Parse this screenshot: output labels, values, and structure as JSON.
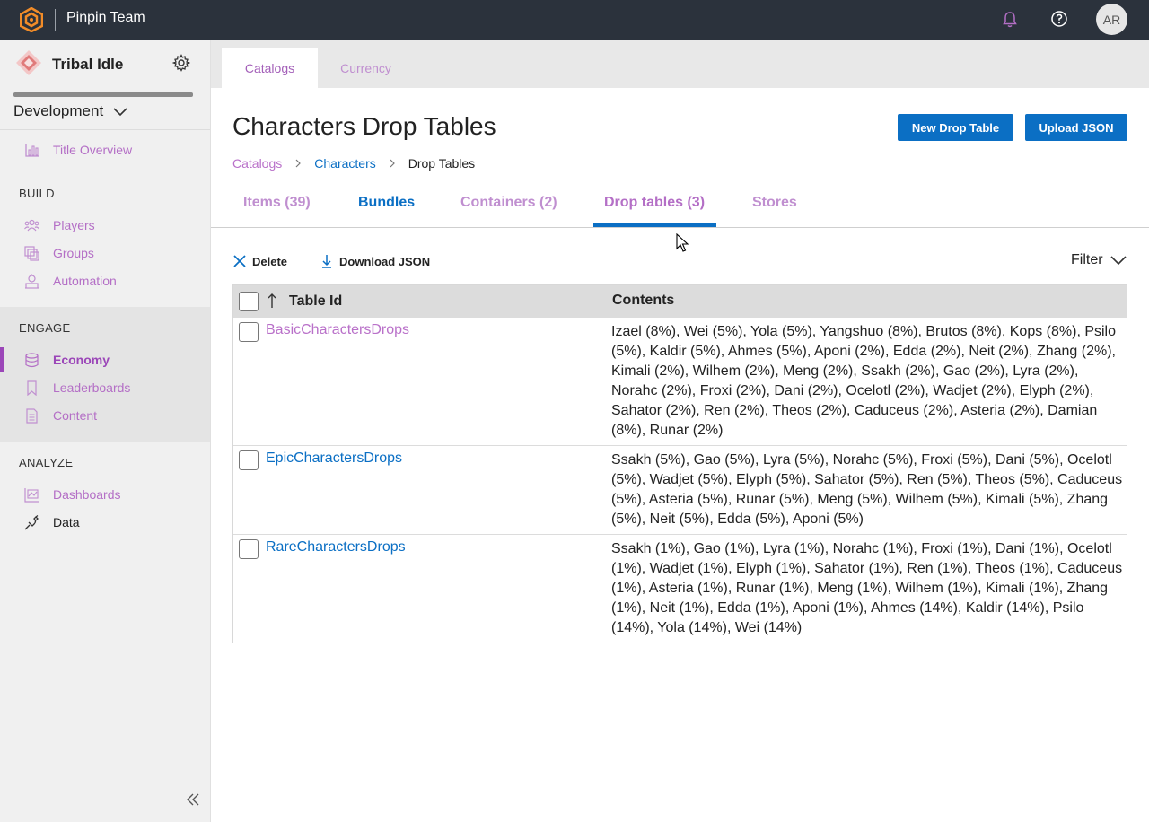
{
  "topbar": {
    "team_name": "Pinpin Team",
    "avatar_initials": "AR",
    "accent": "#f28c28"
  },
  "sidebar": {
    "title": "Tribal Idle",
    "environment": "Development",
    "overview": "Title Overview",
    "sections": {
      "build": "BUILD",
      "engage": "ENGAGE",
      "analyze": "ANALYZE"
    },
    "build_items": [
      "Players",
      "Groups",
      "Automation"
    ],
    "engage_items": [
      "Economy",
      "Leaderboards",
      "Content"
    ],
    "analyze_items": [
      "Dashboards",
      "Data"
    ]
  },
  "top_tabs": [
    "Catalogs",
    "Currency"
  ],
  "page": {
    "title": "Characters Drop Tables",
    "new_button": "New Drop Table",
    "upload_button": "Upload JSON",
    "breadcrumb": [
      "Catalogs",
      "Characters",
      "Drop Tables"
    ]
  },
  "page_tabs": [
    "Items (39)",
    "Bundles",
    "Containers (2)",
    "Drop tables (3)",
    "Stores"
  ],
  "toolbar": {
    "delete": "Delete",
    "download": "Download JSON",
    "filter": "Filter"
  },
  "table": {
    "columns": [
      "Table Id",
      "Contents"
    ],
    "rows": [
      {
        "id": "BasicCharactersDrops",
        "contents": "Izael (8%), Wei (5%), Yola (5%), Yangshuo (8%), Brutos (8%), Kops (8%), Psilo (5%), Kaldir (5%), Ahmes (5%), Aponi (2%), Edda (2%), Neit (2%), Zhang (2%), Kimali (2%), Wilhem (2%), Meng (2%), Ssakh (2%), Gao (2%), Lyra (2%), Norahc (2%), Froxi (2%), Dani (2%), Ocelotl (2%), Wadjet (2%), Elyph (2%), Sahator (2%), Ren (2%), Theos (2%), Caduceus (2%), Asteria (2%), Damian (8%), Runar (2%)"
      },
      {
        "id": "EpicCharactersDrops",
        "contents": "Ssakh (5%), Gao (5%), Lyra (5%), Norahc (5%), Froxi (5%), Dani (5%), Ocelotl (5%), Wadjet (5%), Elyph (5%), Sahator (5%), Ren (5%), Theos (5%), Caduceus (5%), Asteria (5%), Runar (5%), Meng (5%), Wilhem (5%), Kimali (5%), Zhang (5%), Neit (5%), Edda (5%), Aponi (5%)"
      },
      {
        "id": "RareCharactersDrops",
        "contents": "Ssakh (1%), Gao (1%), Lyra (1%), Norahc (1%), Froxi (1%), Dani (1%), Ocelotl (1%), Wadjet (1%), Elyph (1%), Sahator (1%), Ren (1%), Theos (1%), Caduceus (1%), Asteria (1%), Runar (1%), Meng (1%), Wilhem (1%), Kimali (1%), Zhang (1%), Neit (1%), Edda (1%), Aponi (1%), Ahmes (14%), Kaldir (14%), Psilo (14%), Yola (14%), Wei (14%)"
      }
    ]
  }
}
